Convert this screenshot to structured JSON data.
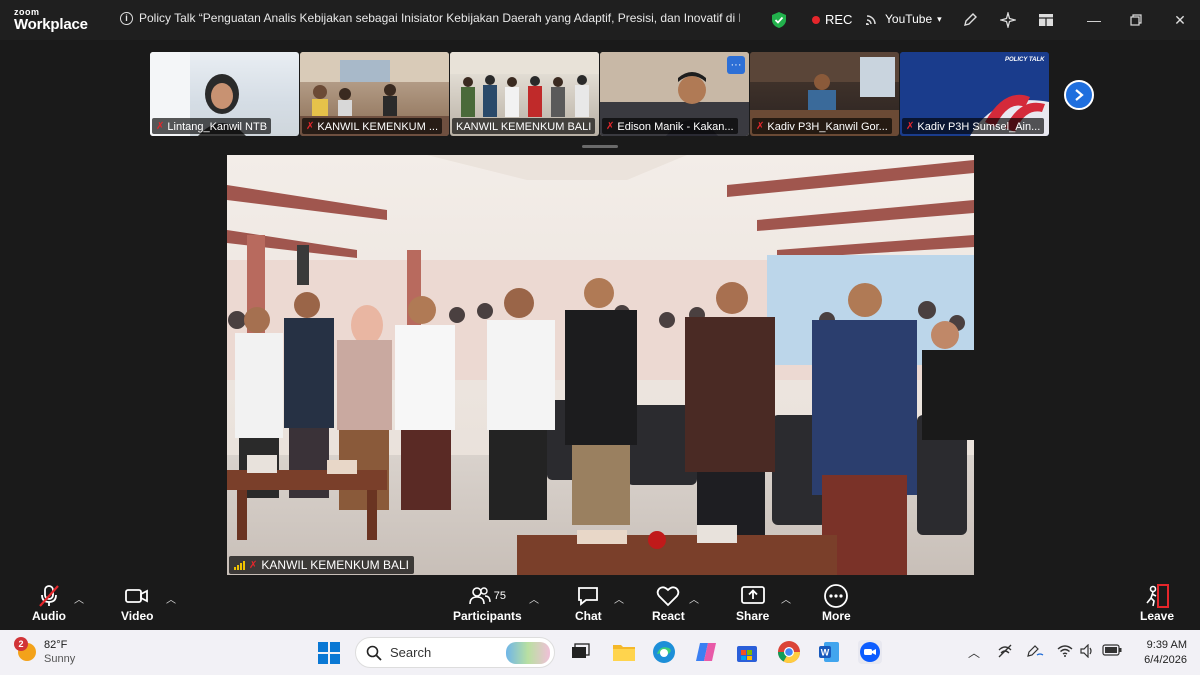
{
  "app": {
    "logo_line1": "zoom",
    "logo_line2": "Workplace"
  },
  "meeting": {
    "title": "Policy Talk “Penguatan Analis Kebijakan sebagai Inisiator Kebijakan Daerah yang Adaptif, Presisi, dan Inovatif di Provinsi B",
    "rec_label": "REC",
    "stream_label": "YouTube"
  },
  "gallery": [
    {
      "name": "Lintang_Kanwil NTB"
    },
    {
      "name": "KANWIL KEMENKUM ..."
    },
    {
      "name": "KANWIL KEMENKUM BALI"
    },
    {
      "name": "Edison Manik - Kakan..."
    },
    {
      "name": "Kadiv P3H_Kanwil Gor..."
    },
    {
      "name": "Kadiv P3H Sumsel_Ain..."
    }
  ],
  "gallery_slide_text": "POLICY TALK",
  "active_speaker": {
    "name": "KANWIL KEMENKUM BALI"
  },
  "toolbar": {
    "audio": "Audio",
    "video": "Video",
    "participants": "Participants",
    "participants_count": "75",
    "chat": "Chat",
    "react": "React",
    "share": "Share",
    "more": "More",
    "leave": "Leave"
  },
  "taskbar": {
    "weather_badge": "2",
    "temperature": "82°F",
    "condition": "Sunny",
    "search_placeholder": "Search",
    "time": "9:39 AM",
    "date": "6/4/2026"
  },
  "colors": {
    "rec_red": "#e5262b",
    "accent_blue": "#1f6fde",
    "leave_red": "#e5262b"
  }
}
